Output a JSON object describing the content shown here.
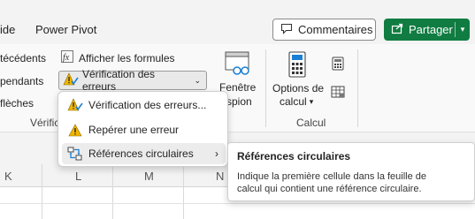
{
  "menubar": {
    "tabs": [
      "ide",
      "Power Pivot"
    ],
    "comments_label": "Commentaires",
    "share_label": "Partager"
  },
  "ribbon": {
    "left_items": [
      "técédents",
      "pendants",
      "flèches"
    ],
    "show_formulas_label": "Afficher les formules",
    "error_check_label": "Vérification des erreurs",
    "group_label_partial": "Vérifica",
    "window": {
      "line1": "Fenêtre",
      "line2": "spion"
    },
    "calc_options": {
      "line1": "Options de",
      "line2": "calcul"
    },
    "calc_group_label": "Calcul"
  },
  "dropdown": {
    "items": [
      {
        "label": "Vérification des erreurs...",
        "icon": "error-check-icon"
      },
      {
        "label": "Repérer une erreur",
        "icon": "warning-icon"
      },
      {
        "label": "Références circulaires",
        "icon": "circular-reference-icon",
        "has_submenu": true
      }
    ]
  },
  "tooltip": {
    "title": "Références circulaires",
    "body": "Indique la première cellule dans la feuille de calcul qui contient une référence circulaire."
  },
  "sheet": {
    "columns": [
      "K",
      "L",
      "M",
      "N"
    ]
  },
  "colors": {
    "accent": "#107c41",
    "warning": "#f2b600"
  }
}
